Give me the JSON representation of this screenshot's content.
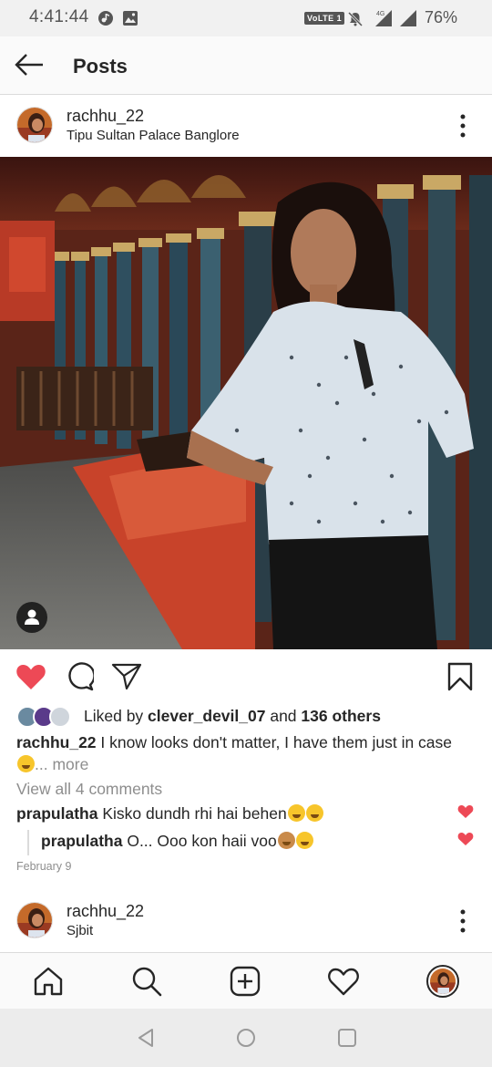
{
  "status_bar": {
    "time": "4:41:44",
    "volte": "VoLTE 1",
    "network": "4G",
    "battery": "76%"
  },
  "header": {
    "title": "Posts"
  },
  "post": {
    "username": "rachhu_22",
    "location": "Tipu Sultan Palace Banglore",
    "likes": {
      "prefix": "Liked by ",
      "liker": "clever_devil_07",
      "middle": " and ",
      "others": "136 others"
    },
    "caption": {
      "username": "rachhu_22",
      "text": " I know looks don't matter, I have them just in case",
      "more": "... more"
    },
    "view_comments": "View all 4 comments",
    "comments": [
      {
        "username": "prapulatha",
        "text": " Kisko dundh rhi hai behen"
      },
      {
        "username": "prapulatha",
        "text": " O... Ooo kon haii voo"
      }
    ],
    "date": "February 9"
  },
  "next_post": {
    "username": "rachhu_22",
    "location": "Sjbit"
  },
  "colors": {
    "like_red": "#ed4956",
    "text": "#262626",
    "muted": "#8e8e8e"
  },
  "icons": {
    "back": "arrow-left-icon",
    "more": "more-vertical-icon",
    "like": "heart-filled-icon",
    "comment": "comment-icon",
    "share": "send-icon",
    "save": "bookmark-icon",
    "home": "home-icon",
    "search": "search-icon",
    "add": "add-post-icon",
    "activity": "heart-outline-icon",
    "profile": "profile-avatar"
  }
}
